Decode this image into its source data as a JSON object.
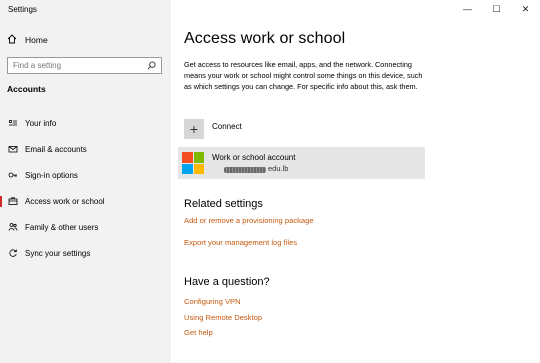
{
  "window": {
    "title": "Settings",
    "controls": {
      "minimize": "—",
      "maximize": "☐",
      "close": "✕"
    }
  },
  "sidebar": {
    "home_label": "Home",
    "search_placeholder": "Find a setting",
    "section_heading": "Accounts",
    "items": [
      {
        "label": "Your info",
        "icon": "person-card-icon",
        "glyph": "≡"
      },
      {
        "label": "Email & accounts",
        "icon": "envelope-icon",
        "glyph": "✉"
      },
      {
        "label": "Sign-in options",
        "icon": "key-icon",
        "glyph": "⚿"
      },
      {
        "label": "Access work or school",
        "icon": "briefcase-icon",
        "glyph": "▭",
        "active": true
      },
      {
        "label": "Family & other users",
        "icon": "users-icon",
        "glyph": "⚇"
      },
      {
        "label": "Sync your settings",
        "icon": "sync-icon",
        "glyph": "↻"
      }
    ],
    "active_color": "#d22a2a"
  },
  "main": {
    "title": "Access work or school",
    "description": "Get access to resources like email, apps, and the network. Connecting means your work or school might control some things on this device, such as which settings you can change. For specific info about this, ask them.",
    "connect_label": "Connect",
    "account": {
      "title": "Work or school account",
      "email": "edu.lb"
    },
    "related_heading": "Related settings",
    "related_links": [
      "Add or remove a provisioning package",
      "Export your management log files"
    ],
    "question_heading": "Have a question?",
    "question_links": [
      "Configuring VPN",
      "Using Remote Desktop",
      "Get help"
    ],
    "link_color": "#c5590f"
  }
}
